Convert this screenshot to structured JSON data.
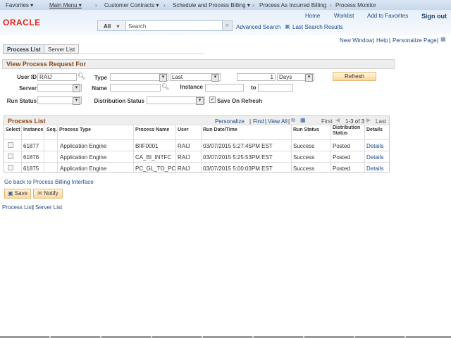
{
  "nav": {
    "favorites": "Favorites ▾",
    "main_menu": "Main Menu ▾",
    "crumbs": [
      "Customer Contracts ▾",
      "Schedule and Process Billing ▾",
      "Process As Incurred Billing",
      "Process Monitor"
    ]
  },
  "header": {
    "logo": "ORACLE",
    "links": [
      "Home",
      "Worklist",
      "Add to Favorites",
      "Sign out"
    ],
    "search_scope": "All",
    "search_placeholder": "Search",
    "advanced_search": "Advanced Search",
    "last_search": "Last Search Results"
  },
  "pagelinks": {
    "new_window": "New Window",
    "help": "Help",
    "personalize": "Personalize Page"
  },
  "tabs": [
    "Process List",
    "Server List"
  ],
  "form": {
    "title": "View Process Request For",
    "user_id_label": "User ID",
    "user_id": "RAIJ",
    "type_label": "Type",
    "type": "",
    "last": "Last",
    "count": "1",
    "unit": "Days",
    "refresh": "Refresh",
    "server_label": "Server",
    "name_label": "Name",
    "instance_label": "Instance",
    "to_label": "to",
    "run_status_label": "Run Status",
    "dist_status_label": "Distribution Status",
    "save_on_refresh": "Save On Refresh",
    "save_on_refresh_checked": true
  },
  "table": {
    "title": "Process List",
    "personalize": "Personalize",
    "find": "Find",
    "view_all": "View All",
    "first": "First",
    "range": "1-3 of 3",
    "last": "Last",
    "columns": [
      "Select",
      "Instance",
      "Seq.",
      "Process Type",
      "Process Name",
      "User",
      "Run Date/Time",
      "Run Status",
      "Distribution Status",
      "Details"
    ],
    "rows": [
      {
        "instance": "61877",
        "seq": "",
        "type": "Application Engine",
        "name": "BIIF0001",
        "user": "RAIJ",
        "datetime": "03/07/2015  5:27:45PM EST",
        "status": "Success",
        "dist": "Posted",
        "details": "Details"
      },
      {
        "instance": "61876",
        "seq": "",
        "type": "Application Engine",
        "name": "CA_BI_INTFC",
        "user": "RAIJ",
        "datetime": "03/07/2015  5:25:53PM EST",
        "status": "Success",
        "dist": "Posted",
        "details": "Details"
      },
      {
        "instance": "61875",
        "seq": "",
        "type": "Application Engine",
        "name": "PC_GL_TO_PC",
        "user": "RAIJ",
        "datetime": "03/07/2015  5:00:03PM EST",
        "status": "Success",
        "dist": "Posted",
        "details": "Details"
      }
    ]
  },
  "go_back": "Go back to Process Billing Interface",
  "buttons": {
    "save": "Save",
    "notify": "Notify"
  },
  "footer": {
    "process_list": "Process List",
    "server_list": "Server List"
  }
}
